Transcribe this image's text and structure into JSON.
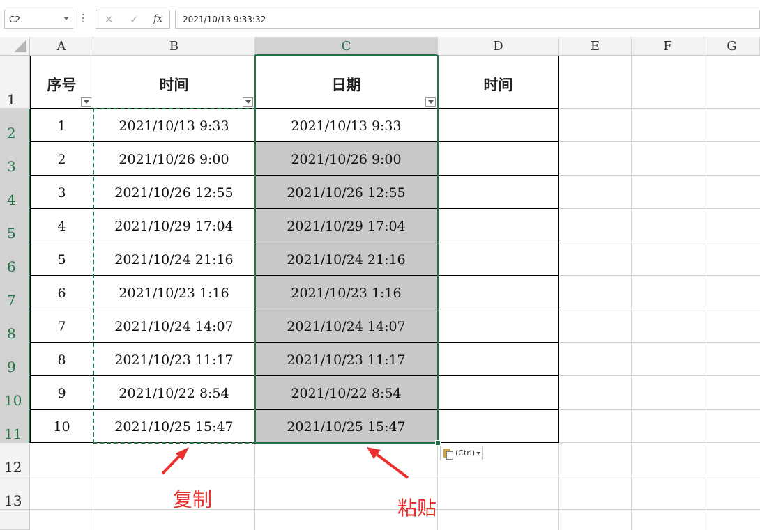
{
  "formula_bar": {
    "name_box": "C2",
    "cancel_icon": "✕",
    "enter_icon": "✓",
    "fx_label": "fx",
    "formula": "2021/10/13  9:33:32"
  },
  "column_headers": [
    "A",
    "B",
    "C",
    "D",
    "E",
    "F",
    "G"
  ],
  "row_headers": [
    "1",
    "2",
    "3",
    "4",
    "5",
    "6",
    "7",
    "8",
    "9",
    "10",
    "11",
    "12",
    "13"
  ],
  "table": {
    "headers": [
      "序号",
      "时间",
      "日期",
      "时间"
    ],
    "rows": [
      {
        "seq": "1",
        "time": "2021/10/13  9:33",
        "date": "2021/10/13  9:33"
      },
      {
        "seq": "2",
        "time": "2021/10/26  9:00",
        "date": "2021/10/26  9:00"
      },
      {
        "seq": "3",
        "time": "2021/10/26  12:55",
        "date": "2021/10/26  12:55"
      },
      {
        "seq": "4",
        "time": "2021/10/29  17:04",
        "date": "2021/10/29  17:04"
      },
      {
        "seq": "5",
        "time": "2021/10/24  21:16",
        "date": "2021/10/24  21:16"
      },
      {
        "seq": "6",
        "time": "2021/10/23  1:16",
        "date": "2021/10/23  1:16"
      },
      {
        "seq": "7",
        "time": "2021/10/24  14:07",
        "date": "2021/10/24  14:07"
      },
      {
        "seq": "8",
        "time": "2021/10/23  11:17",
        "date": "2021/10/23  11:17"
      },
      {
        "seq": "9",
        "time": "2021/10/22  8:54",
        "date": "2021/10/22  8:54"
      },
      {
        "seq": "10",
        "time": "2021/10/25  15:47",
        "date": "2021/10/25  15:47"
      }
    ]
  },
  "paste_options": "(Ctrl)",
  "annotations": {
    "copy": "复制",
    "paste": "粘贴"
  },
  "colors": {
    "selection": "#217346",
    "annotation": "#e8312f",
    "highlight": "#c8c8c8"
  }
}
